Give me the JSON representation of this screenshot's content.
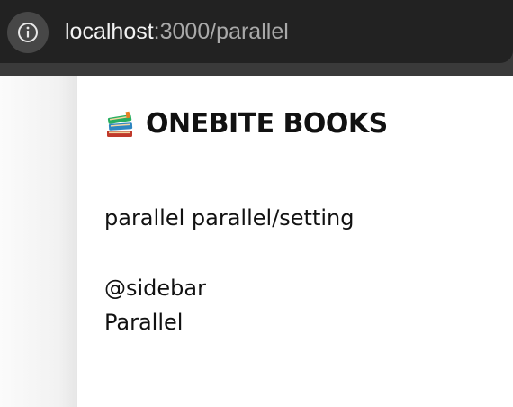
{
  "browser": {
    "address_host": "localhost",
    "address_path": ":3000/parallel"
  },
  "header": {
    "logo_icon": "books-icon",
    "title": "ONEBITE BOOKS"
  },
  "content": {
    "main_line": "parallel parallel/setting",
    "sidebar_label": "@sidebar",
    "sidebar_content": "Parallel"
  },
  "colors": {
    "browser_bar": "#222222",
    "page_background": "#ffffff",
    "text": "#111111"
  }
}
